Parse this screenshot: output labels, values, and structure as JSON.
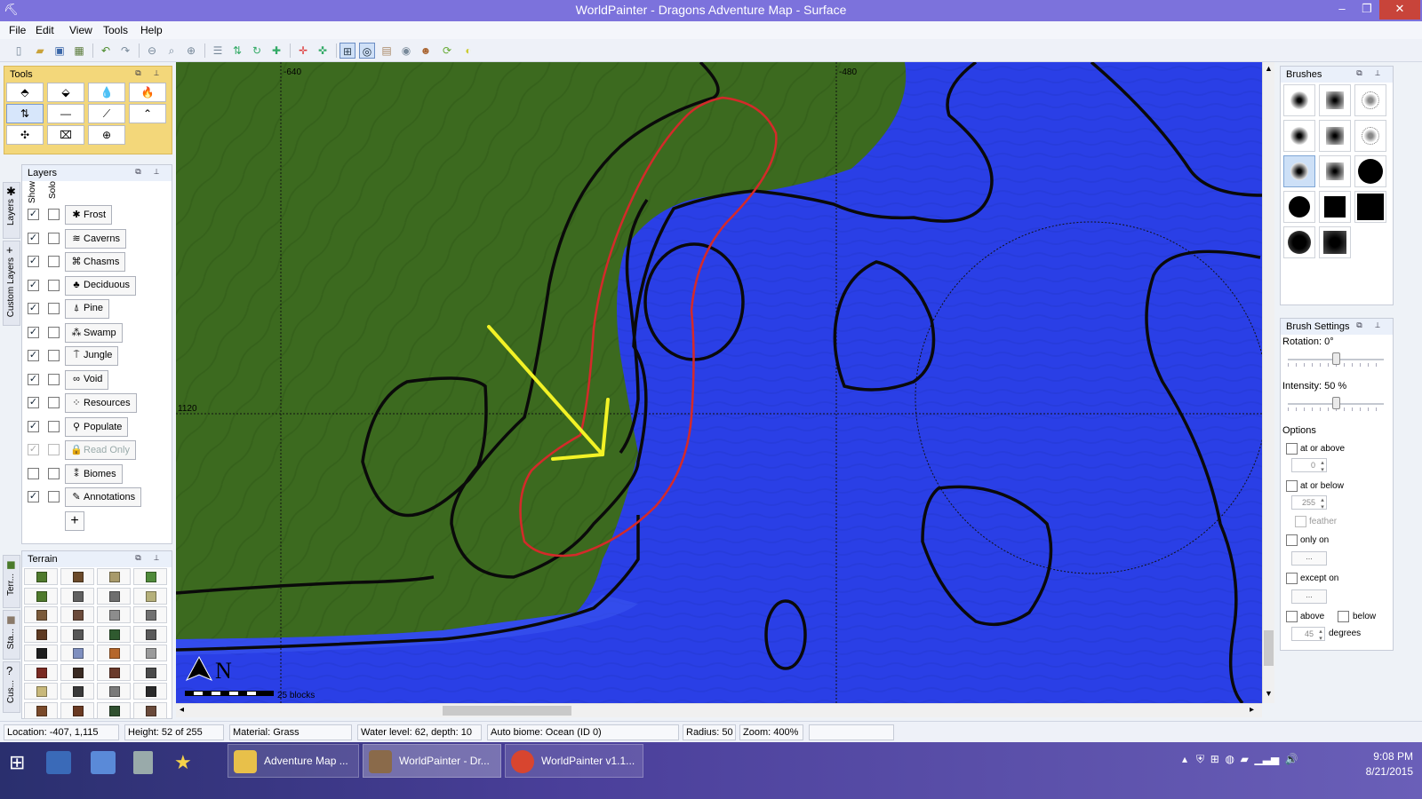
{
  "window": {
    "title": "WorldPainter - Dragons Adventure Map - Surface",
    "controls": [
      "–",
      "❐",
      "✕"
    ]
  },
  "menu": [
    "File",
    "Edit",
    "View",
    "Tools",
    "Help"
  ],
  "tools_panel": {
    "title": "Tools",
    "tools": [
      {
        "icon": "raise-mountain-icon",
        "glyph": "⬘"
      },
      {
        "icon": "lower-mountain-icon",
        "glyph": "⬙"
      },
      {
        "icon": "flood-icon",
        "glyph": "💧"
      },
      {
        "icon": "lava-flood-icon",
        "glyph": "🔥"
      },
      {
        "icon": "smooth-icon",
        "glyph": "⇅"
      },
      {
        "icon": "flatten-icon",
        "glyph": "—"
      },
      {
        "icon": "slope-icon",
        "glyph": "⟋"
      },
      {
        "icon": "ramp-icon",
        "glyph": "⌃"
      },
      {
        "icon": "sponge-icon",
        "glyph": "✣"
      },
      {
        "icon": "text-icon",
        "glyph": "⌧"
      },
      {
        "icon": "global-operation-icon",
        "glyph": "⊕"
      }
    ]
  },
  "side_tabs": [
    {
      "label": "Layers",
      "icon": "frost-icon"
    },
    {
      "label": "Custom Layers",
      "icon": "plus-icon"
    },
    {
      "label": "Terr...",
      "icon": "terrain-cube-icon"
    },
    {
      "label": "Sta...",
      "icon": "stamp-icon"
    },
    {
      "label": "Cus...",
      "icon": "help-icon"
    }
  ],
  "layers_panel": {
    "title": "Layers",
    "col_show": "Show",
    "col_solo": "Solo",
    "layers": [
      {
        "name": "Frost",
        "show": true,
        "solo": false,
        "icon": "✱",
        "dim": false
      },
      {
        "name": "Caverns",
        "show": true,
        "solo": false,
        "icon": "≋",
        "dim": false
      },
      {
        "name": "Chasms",
        "show": true,
        "solo": false,
        "icon": "⌘",
        "dim": false
      },
      {
        "name": "Deciduous",
        "show": true,
        "solo": false,
        "icon": "♣",
        "dim": false
      },
      {
        "name": "Pine",
        "show": true,
        "solo": false,
        "icon": "⍋",
        "dim": false
      },
      {
        "name": "Swamp",
        "show": true,
        "solo": false,
        "icon": "⁂",
        "dim": false
      },
      {
        "name": "Jungle",
        "show": true,
        "solo": false,
        "icon": "⍑",
        "dim": false
      },
      {
        "name": "Void",
        "show": true,
        "solo": false,
        "icon": "∞",
        "dim": false
      },
      {
        "name": "Resources",
        "show": true,
        "solo": false,
        "icon": "⁘",
        "dim": false
      },
      {
        "name": "Populate",
        "show": true,
        "solo": false,
        "icon": "⚲",
        "dim": false
      },
      {
        "name": "Read Only",
        "show": true,
        "solo": false,
        "icon": "🔒",
        "dim": true
      },
      {
        "name": "Biomes",
        "show": false,
        "solo": false,
        "icon": "⁑",
        "dim": false
      },
      {
        "name": "Annotations",
        "show": true,
        "solo": false,
        "icon": "✎",
        "dim": false
      }
    ],
    "add_label": "+"
  },
  "terrain_panel": {
    "title": "Terrain",
    "colors": [
      "#4f7a2c",
      "#6b4a2a",
      "#a89a6b",
      "#4f8a3a",
      "#4f7a2c",
      "#606060",
      "#6e6e6e",
      "#b5b07a",
      "#7a5a3a",
      "#6a4a3a",
      "#8d8d8d",
      "#707070",
      "#5e3a22",
      "#565656",
      "#2f5a2f",
      "#5a5a5a",
      "#1e1e1e",
      "#7f8fbf",
      "#b5662a",
      "#9a9a9a",
      "#7a2a22",
      "#3a2a22",
      "#6a3a2a",
      "#4a4a4a",
      "#c8b87a",
      "#3a3a3a",
      "#7a7a7a",
      "#2a2a2a",
      "#7a4a2a",
      "#6a3a22",
      "#2f4f2f",
      "#6a4a3a"
    ]
  },
  "map": {
    "ruler_x": [
      "-640",
      "-480"
    ],
    "ruler_y": [
      "1120"
    ],
    "compass_label": "N",
    "scale_label": "25 blocks",
    "colors": {
      "land": "#3c6a1f",
      "water": "#2a3fe6",
      "contour": "#0a0a0a",
      "annotation_red": "#d42a2a",
      "annotation_yellow": "#f2f226"
    }
  },
  "brushes_panel": {
    "title": "Brushes",
    "brushes": [
      {
        "shape": "soft-circle",
        "selected": false
      },
      {
        "shape": "soft-square",
        "selected": false
      },
      {
        "shape": "noise",
        "selected": false
      },
      {
        "shape": "medium-circle",
        "selected": false
      },
      {
        "shape": "medium-square",
        "selected": false
      },
      {
        "shape": "noise-2",
        "selected": false
      },
      {
        "shape": "spike-circle",
        "selected": true
      },
      {
        "shape": "spike-square",
        "selected": false
      },
      {
        "shape": "hard-circle",
        "selected": false
      },
      {
        "shape": "solid-circle",
        "selected": false
      },
      {
        "shape": "solid-square",
        "selected": false
      },
      {
        "shape": "solid-square-big",
        "selected": false
      },
      {
        "shape": "dark-soft-circle",
        "selected": false
      },
      {
        "shape": "dark-soft-square",
        "selected": false
      }
    ]
  },
  "brush_settings": {
    "title": "Brush Settings",
    "rotation_label": "Rotation: 0°",
    "rotation": 0.5,
    "intensity_label": "Intensity: 50 %",
    "intensity": 0.5,
    "options_label": "Options",
    "at_or_above": "at or above",
    "at_or_above_value": "0",
    "at_or_below": "at or below",
    "at_or_below_value": "255",
    "feather": "feather",
    "only_on": "only on",
    "only_on_value": "...",
    "except_on": "except on",
    "except_on_value": "...",
    "above": "above",
    "below": "below",
    "degrees_value": "45",
    "degrees": "degrees"
  },
  "status": {
    "location": "Location: -407, 1,115",
    "height": "Height: 52 of 255",
    "material": "Material: Grass",
    "water": "Water level: 62, depth: 10",
    "biome": "Auto biome: Ocean (ID 0)",
    "radius": "Radius: 50",
    "zoom": "Zoom: 400%"
  },
  "taskbar": {
    "items": [
      {
        "label": "Adventure Map ...",
        "color": "#e8c04a"
      },
      {
        "label": "WorldPainter - Dr...",
        "color": "#8a6a4a"
      },
      {
        "label": "WorldPainter v1.1...",
        "color": "#d8452f"
      }
    ],
    "time": "9:08 PM",
    "date": "8/21/2015"
  }
}
